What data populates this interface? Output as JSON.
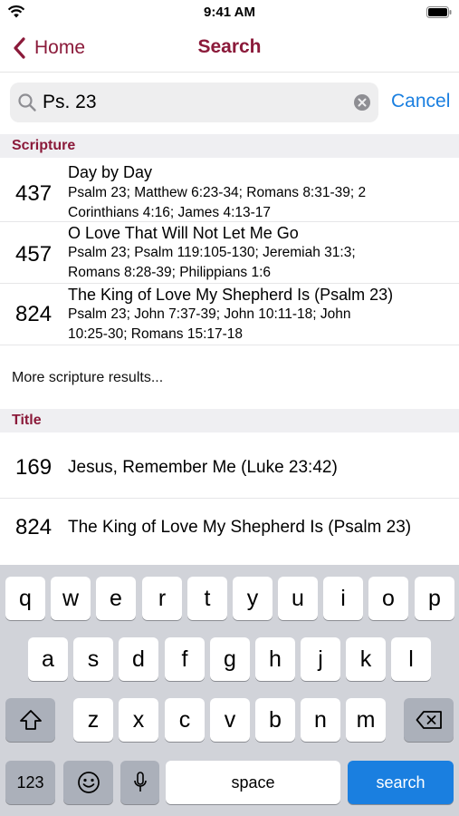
{
  "status_bar": {
    "time": "9:41 AM"
  },
  "nav": {
    "back_label": "Home",
    "title": "Search"
  },
  "search": {
    "value": "Ps. 23",
    "cancel_label": "Cancel"
  },
  "sections": {
    "scripture": {
      "header": "Scripture",
      "results": [
        {
          "number": "437",
          "title": "Day by Day",
          "refs_line1": "Psalm 23; Matthew 6:23-34; Romans 8:31-39; 2",
          "refs_line2": "Corinthians 4:16; James 4:13-17"
        },
        {
          "number": "457",
          "title": "O Love That Will Not Let Me Go",
          "refs_line1": "Psalm 23; Psalm 119:105-130; Jeremiah 31:3;",
          "refs_line2": "Romans 8:28-39; Philippians 1:6"
        },
        {
          "number": "824",
          "title": "The King of Love My Shepherd Is (Psalm 23)",
          "refs_line1": "Psalm 23; John 7:37-39; John 10:11-18; John",
          "refs_line2": "10:25-30; Romans 15:17-18"
        }
      ],
      "more_label": "More scripture results..."
    },
    "title": {
      "header": "Title",
      "results": [
        {
          "number": "169",
          "title": "Jesus, Remember Me (Luke 23:42)"
        },
        {
          "number": "824",
          "title": "The King of Love My Shepherd Is (Psalm 23)"
        }
      ]
    }
  },
  "keyboard": {
    "row1": [
      "q",
      "w",
      "e",
      "r",
      "t",
      "y",
      "u",
      "i",
      "o",
      "p"
    ],
    "row2": [
      "a",
      "s",
      "d",
      "f",
      "g",
      "h",
      "j",
      "k",
      "l"
    ],
    "row3": [
      "z",
      "x",
      "c",
      "v",
      "b",
      "n",
      "m"
    ],
    "numbers_label": "123",
    "space_label": "space",
    "search_label": "search"
  },
  "colors": {
    "accent": "#8b1a3a",
    "link": "#1a7fe0",
    "section_bg": "#efeff2",
    "keyboard_bg": "#d1d3d9"
  },
  "icons": [
    "wifi-icon",
    "battery-icon",
    "chevron-left-icon",
    "search-icon",
    "clear-icon",
    "shift-icon",
    "emoji-icon",
    "microphone-icon",
    "delete-icon"
  ]
}
